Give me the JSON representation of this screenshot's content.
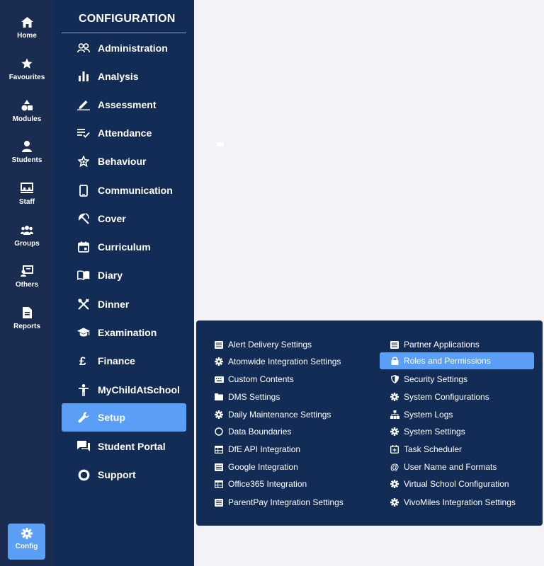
{
  "rail": {
    "items": [
      {
        "label": "Home",
        "icon": "home-icon"
      },
      {
        "label": "Favourites",
        "icon": "star-icon"
      },
      {
        "label": "Modules",
        "icon": "shapes-icon"
      },
      {
        "label": "Students",
        "icon": "person-icon"
      },
      {
        "label": "Staff",
        "icon": "classroom-icon"
      },
      {
        "label": "Groups",
        "icon": "group-icon"
      },
      {
        "label": "Others",
        "icon": "presenter-icon"
      },
      {
        "label": "Reports",
        "icon": "document-icon"
      }
    ],
    "config_label": "Config"
  },
  "menu": {
    "title": "CONFIGURATION",
    "items": [
      {
        "label": "Administration",
        "icon": "people-icon"
      },
      {
        "label": "Analysis",
        "icon": "bar-chart-icon"
      },
      {
        "label": "Assessment",
        "icon": "pen-icon"
      },
      {
        "label": "Attendance",
        "icon": "checklist-icon"
      },
      {
        "label": "Behaviour",
        "icon": "star-outline-icon"
      },
      {
        "label": "Communication",
        "icon": "phone-icon"
      },
      {
        "label": "Cover",
        "icon": "umbrella-icon"
      },
      {
        "label": "Curriculum",
        "icon": "calendar-icon"
      },
      {
        "label": "Diary",
        "icon": "book-icon"
      },
      {
        "label": "Dinner",
        "icon": "cutlery-icon"
      },
      {
        "label": "Examination",
        "icon": "graduation-cap-icon"
      },
      {
        "label": "Finance",
        "icon": "pound-icon"
      },
      {
        "label": "MyChildAtSchool",
        "icon": "child-icon"
      },
      {
        "label": "Setup",
        "icon": "wrench-icon"
      },
      {
        "label": "Student Portal",
        "icon": "chat-icon"
      },
      {
        "label": "Support",
        "icon": "lifebuoy-icon"
      }
    ],
    "active": "Setup"
  },
  "setup_submenu": {
    "left": [
      {
        "label": "Alert Delivery Settings",
        "icon": "list-icon"
      },
      {
        "label": "Atomwide Integration Settings",
        "icon": "cog-icon"
      },
      {
        "label": "Custom Contents",
        "icon": "keyboard-icon"
      },
      {
        "label": "DMS Settings",
        "icon": "folder-icon"
      },
      {
        "label": "Daily Maintenance Settings",
        "icon": "cog-icon"
      },
      {
        "label": "Data Boundaries",
        "icon": "circle-icon"
      },
      {
        "label": "DfE API Integration",
        "icon": "table-icon"
      },
      {
        "label": "Google Integration",
        "icon": "list-icon"
      },
      {
        "label": "Office365 Integration",
        "icon": "table-icon"
      },
      {
        "label": "ParentPay Integration Settings",
        "icon": "list-icon"
      }
    ],
    "right": [
      {
        "label": "Partner Applications",
        "icon": "list-icon"
      },
      {
        "label": "Roles and Permissions",
        "icon": "lock-icon"
      },
      {
        "label": "Security Settings",
        "icon": "shield-icon"
      },
      {
        "label": "System Configurations",
        "icon": "cog-icon"
      },
      {
        "label": "System Logs",
        "icon": "sitemap-icon"
      },
      {
        "label": "System Settings",
        "icon": "cog-icon"
      },
      {
        "label": "Task Scheduler",
        "icon": "calendar-plus-icon"
      },
      {
        "label": "User Name and Formats",
        "icon": "at-icon"
      },
      {
        "label": "Virtual School Configuration",
        "icon": "cog-icon"
      },
      {
        "label": "VivoMiles Integration Settings",
        "icon": "cog-icon"
      }
    ],
    "active": "Roles and Permissions"
  },
  "colors": {
    "rail_bg": "#1a2c4f",
    "menu_bg": "#132c55",
    "accent": "#5a9ff5",
    "page_bg": "#f2f3f6"
  }
}
